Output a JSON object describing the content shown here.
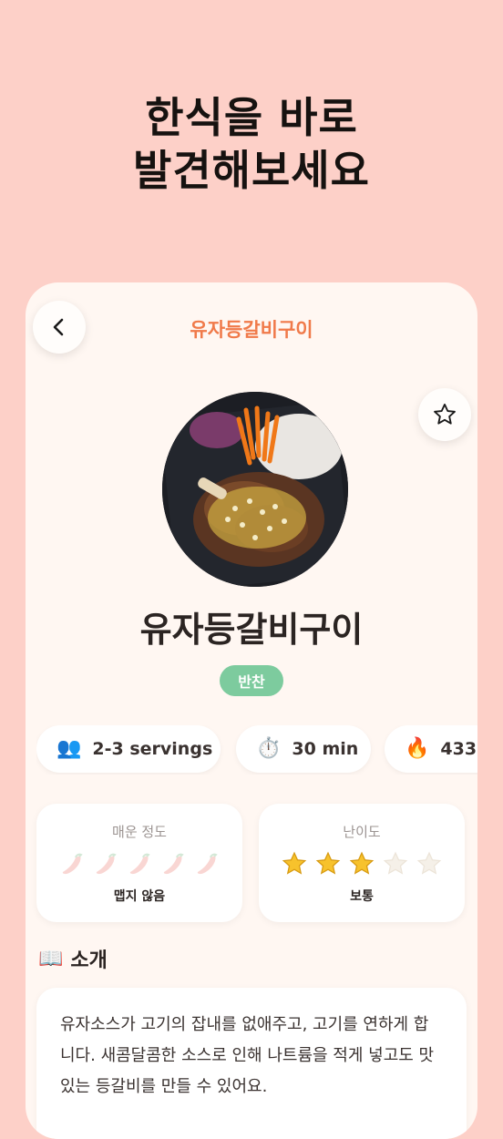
{
  "headline": {
    "line1": "한식을 바로",
    "line2": "발견해보세요"
  },
  "header": {
    "title": "유자등갈비구이",
    "back_icon": "chevron-left-icon",
    "favorite_icon": "star-outline-icon"
  },
  "dish": {
    "name": "유자등갈비구이",
    "category_tag": "반찬"
  },
  "info_pills": [
    {
      "icon": "people-icon",
      "label": "2-3 servings"
    },
    {
      "icon": "stopwatch-icon",
      "label": "30 min"
    },
    {
      "icon": "fire-icon",
      "label": "433"
    }
  ],
  "spice": {
    "label": "매운 정도",
    "level": 0,
    "max": 5,
    "value_text": "맵지 않음"
  },
  "difficulty": {
    "label": "난이도",
    "rating": 3,
    "max": 5,
    "value_text": "보통"
  },
  "intro": {
    "icon": "book-icon",
    "title": "소개",
    "text": "유자소스가 고기의 잡내를 없애주고, 고기를 연하게 합니다. 새콤달콤한 소스로 인해 나트륨을 적게 넣고도 맛있는 등갈비를 만들 수 있어요."
  },
  "colors": {
    "background": "#fdd0c8",
    "card": "#fff7f2",
    "accent": "#f07a4a",
    "tag": "#7dcb9e"
  }
}
